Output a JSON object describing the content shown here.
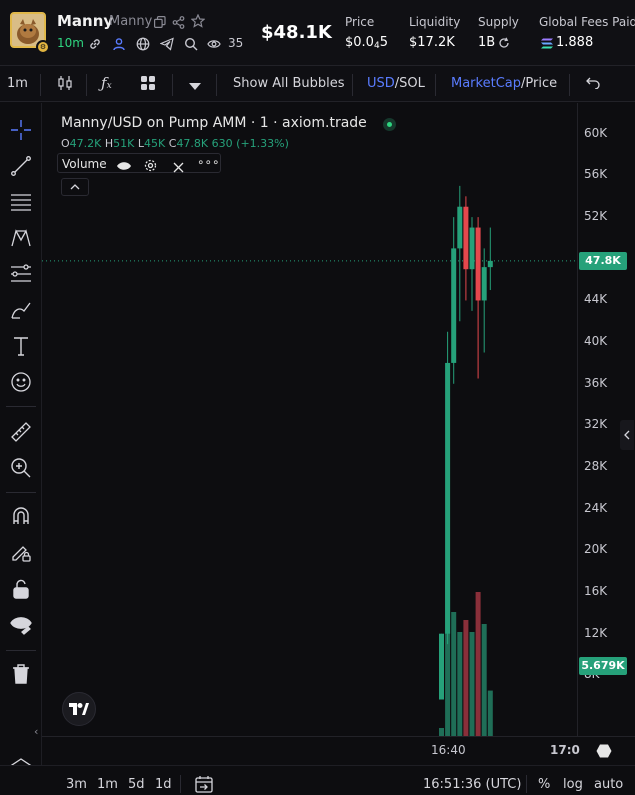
{
  "header": {
    "token_name": "Manny",
    "ticker": "Manny",
    "age": "10m",
    "watchers": "35",
    "market_cap": "$48.1K",
    "stats": [
      {
        "label": "Price",
        "value_main": "$0.0",
        "value_sub": "4",
        "value_tail": "5"
      },
      {
        "label": "Liquidity",
        "value": "$17.2K"
      },
      {
        "label": "Supply",
        "value": "1B"
      },
      {
        "label": "Global Fees Paid",
        "value": "1.888"
      }
    ]
  },
  "toolbar": {
    "interval": "1m",
    "show_bubbles": "Show All Bubbles",
    "currency_active": "USD",
    "currency_sep": "/",
    "currency_other": "SOL",
    "metric_active": "MarketCap",
    "metric_sep": "/",
    "metric_other": "Price"
  },
  "legend": {
    "title": "Manny/USD on Pump AMM · 1 · axiom.trade",
    "o_label": "O",
    "o": "47.2K",
    "h_label": "H",
    "h": "51K",
    "l_label": "L",
    "l": "45K",
    "c_label": "C",
    "c": "47.8K",
    "change": "630 (+1.33%)",
    "volume_label": "Volume"
  },
  "price_axis": {
    "ticks": [
      "60K",
      "56K",
      "52K",
      "48K",
      "44K",
      "40K",
      "36K",
      "32K",
      "28K",
      "24K",
      "20K",
      "16K",
      "12K",
      "8K"
    ],
    "current_price_tag": "47.8K",
    "current_volume_tag": "5.679K"
  },
  "time_axis": {
    "ticks": [
      "16:40",
      "17:0"
    ]
  },
  "bottom": {
    "ranges": [
      "3m",
      "1m",
      "5d",
      "1d"
    ],
    "clock": "16:51:36 (UTC)",
    "percent": "%",
    "log": "log",
    "auto": "auto"
  },
  "colors": {
    "up": "#26a17a",
    "down": "#e5484d",
    "accent": "#5a7cff",
    "green_text": "#2fd480"
  },
  "chart_data": {
    "type": "candlestick",
    "ylim": [
      4000,
      62000
    ],
    "candles": [
      {
        "o": 5679,
        "h": 12000,
        "l": 5679,
        "c": 12000
      },
      {
        "o": 12000,
        "h": 41000,
        "l": 11000,
        "c": 38000
      },
      {
        "o": 38000,
        "h": 52000,
        "l": 36000,
        "c": 49000
      },
      {
        "o": 49000,
        "h": 55000,
        "l": 42000,
        "c": 53000
      },
      {
        "o": 53000,
        "h": 54000,
        "l": 44000,
        "c": 47000
      },
      {
        "o": 47000,
        "h": 52000,
        "l": 43000,
        "c": 51000
      },
      {
        "o": 51000,
        "h": 52000,
        "l": 36500,
        "c": 44000
      },
      {
        "o": 44000,
        "h": 49000,
        "l": 39000,
        "c": 47200
      },
      {
        "o": 47200,
        "h": 51000,
        "l": 45000,
        "c": 47800
      }
    ],
    "volumes": [
      1000,
      19500,
      15500,
      13000,
      14500,
      13000,
      18000,
      14000,
      5679
    ],
    "current": 47800,
    "volume_max": 20000
  }
}
